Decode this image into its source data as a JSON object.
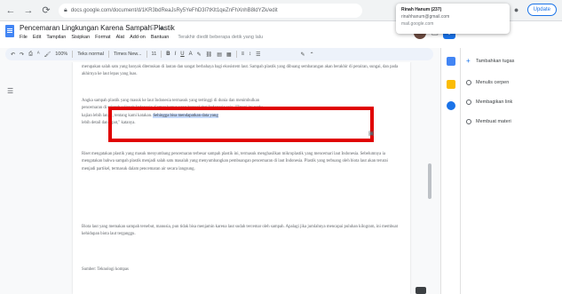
{
  "browser": {
    "url": "docs.google.com/document/d/1KR3bdReaJsRy5YeFhD3l7tKlt1qeZnFhXnhB8ldYZk/edit",
    "updates_label": "Update"
  },
  "account_popup": {
    "name": "Rinah Hanum (237)",
    "email": "rinahhanum@gmail.com",
    "sub": "mail.google.com"
  },
  "doc": {
    "title": "Pencemaran Lingkungan Karena Sampah Plastik",
    "menus": [
      "File",
      "Edit",
      "Tampilan",
      "Sisipkan",
      "Format",
      "Alat",
      "Add-on",
      "Bantuan"
    ],
    "last_edit": "Terakhir diedit beberapa detik yang lalu"
  },
  "toolbar": {
    "zoom": "100%",
    "style": "Teks normal",
    "font": "Times New...",
    "size": "11"
  },
  "paragraphs": {
    "p1": "merupakan salah satu yang banyak ditemukan di lautan dan sangat berbahaya bagi ekosistem laut. Sampah plastik yang dibuang sembarangan akan berakhir di perairan, sungai, dan pada akhirnya ke laut lepas yang luas.",
    "p2_line1": "Angka sampah plastik yang masuk ke laut Indonesia termasuk yang tertinggi di dunia dan menimbulkan",
    "p2_line2": "pencemaran di seluruh wilayah Indonesia. Semua hanya yang berasal dari Indonesia saja. \"Tetapi ini perlu",
    "p2_line3a": "kajian lebih lanjut, tentang kami katakan.",
    "p2_line3b": "Sehingga bisa mendapatkan data yang",
    "p2_line4": "lebih detail dan tepat,\" katanya.",
    "p3": "Riset mengatakan plastik yang masuk menyumbang pencemaran terbesar sampah plastik ini, termasuk menghasilkan mikroplastik yang mencemari laut Indonesia. Sebelumnya ia mengatakan bahwa sampah plastik menjadi salah satu masalah yang menyumbangkan pembuangan pencemaran di laut Indonesia. Plastik yang terbuang oleh biota laut akan terurai menjadi partikel, termasuk dalam pencemaran air secara langsung.",
    "p4": "Biota laut yang memakan sampah tersebut, manusia, pun tidak bisa menjamin karena laut sudah tercemar oleh sampah. Apalagi jika jumlahnya mencapai puluhan kilogram, ini membuat kehidupan biota laut terganggu.",
    "p5": "Sumber: Teknologi kompas"
  },
  "tasks": {
    "add_label": "Tambahkan tugas",
    "items": [
      "Menulis cerpen",
      "Membagikan link",
      "Membuat materi"
    ]
  },
  "colors": {
    "highlight": "#c6dafc",
    "red_box": "#e00000",
    "accent": "#1a73e8"
  }
}
